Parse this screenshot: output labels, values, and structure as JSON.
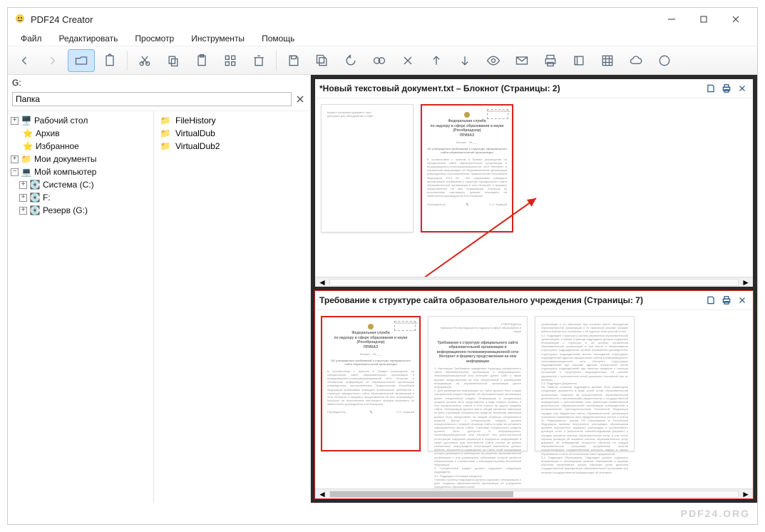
{
  "window": {
    "title": "PDF24 Creator"
  },
  "menu": {
    "file": "Файл",
    "edit": "Редактировать",
    "view": "Просмотр",
    "tools": "Инструменты",
    "help": "Помощь"
  },
  "left": {
    "path": "G:",
    "dropdown": "Папка"
  },
  "tree": {
    "desktop": "Рабочий стол",
    "archive": "Архив",
    "favorites": "Избранное",
    "mydocs": "Мои документы",
    "mycomp": "Мой компьютер",
    "system": "Система (C:)",
    "f": "F:",
    "reserve": "Резерв (G:)"
  },
  "folders": {
    "f1": "FileHistory",
    "f2": "VirtualDub",
    "f3": "VirtualDub2"
  },
  "doc1": {
    "title": "*Новый текстовый документ.txt – Блокнот (Страницы: 2)"
  },
  "doc2": {
    "title": "Требование к структуре сайта образовательного учреждения (Страницы: 7)"
  },
  "footer": {
    "brand": "PDF24.ORG"
  }
}
